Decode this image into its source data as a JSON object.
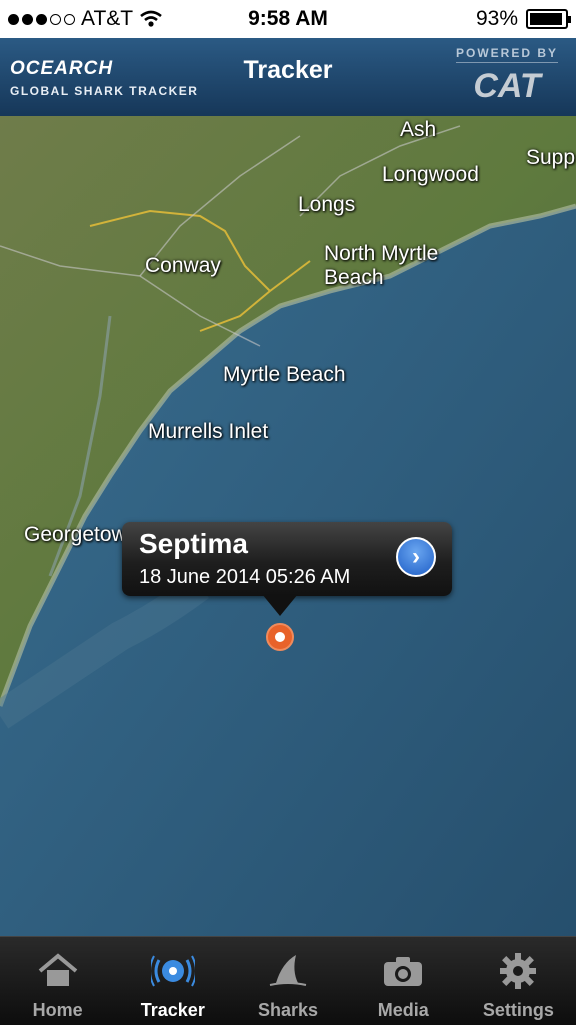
{
  "status_bar": {
    "carrier": "AT&T",
    "time": "9:58 AM",
    "battery": "93%",
    "battery_level": 0.93
  },
  "header": {
    "brand_logo": "OCEARCH",
    "brand_subtitle": "GLOBAL SHARK TRACKER",
    "title": "Tracker",
    "powered_by": "POWERED BY",
    "sponsor": "CAT"
  },
  "map": {
    "labels": [
      "Ash",
      "Longwood",
      "Supp",
      "Longs",
      "North Myrtle",
      "Beach",
      "Conway",
      "Myrtle Beach",
      "Murrells Inlet",
      "Georgetown"
    ]
  },
  "callout": {
    "name": "Septima",
    "date": "18 June 2014 05:26 AM"
  },
  "tabs": [
    {
      "label": "Home",
      "icon": "home-icon"
    },
    {
      "label": "Tracker",
      "icon": "tracker-icon"
    },
    {
      "label": "Sharks",
      "icon": "shark-fin-icon"
    },
    {
      "label": "Media",
      "icon": "camera-icon"
    },
    {
      "label": "Settings",
      "icon": "gear-icon"
    }
  ]
}
